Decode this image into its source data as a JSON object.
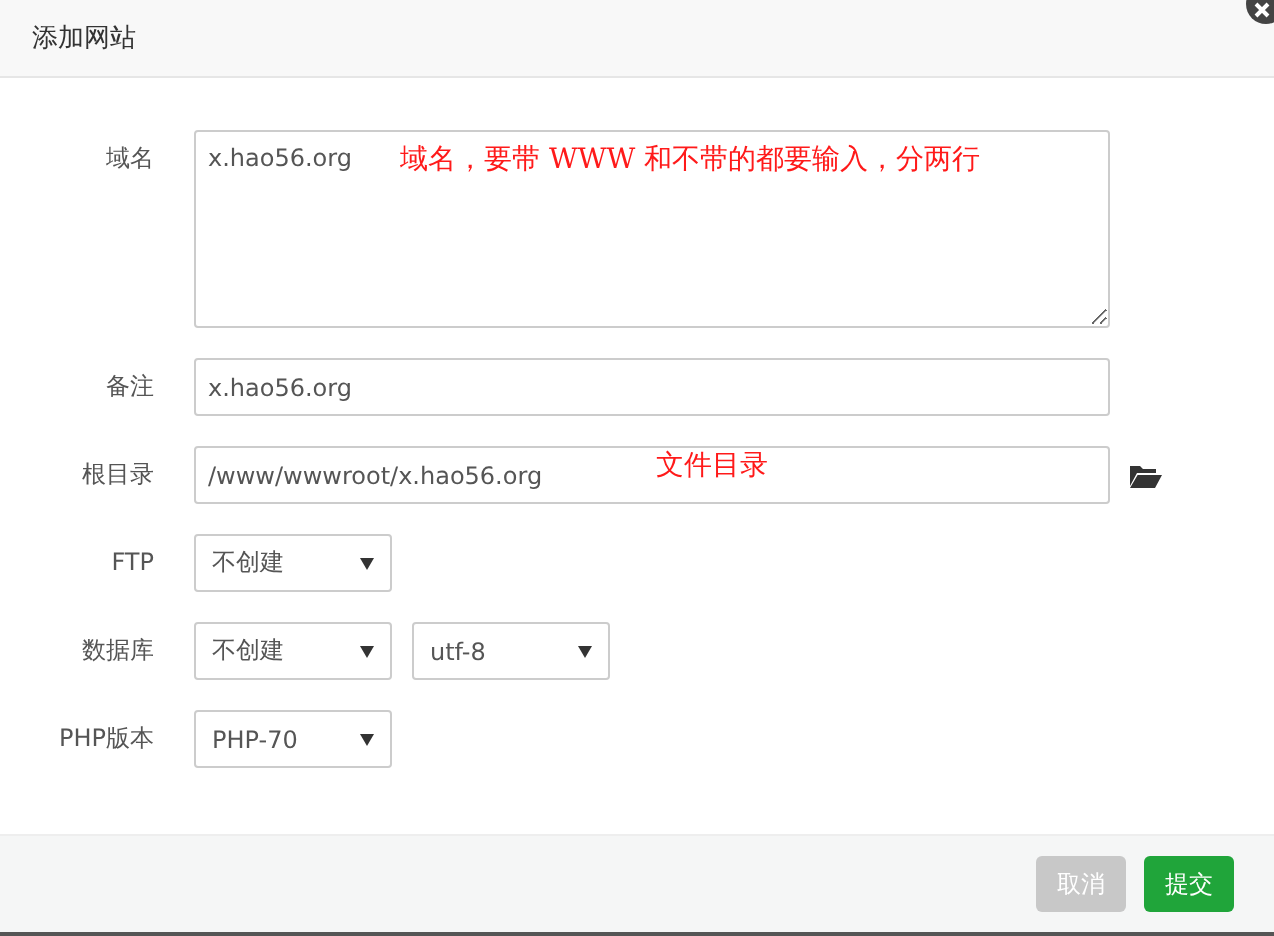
{
  "dialog": {
    "title": "添加网站",
    "closable": true
  },
  "fields": [
    {
      "kind": "textarea",
      "label": "域名",
      "value": "x.hao56.org",
      "note": "域名，要带 WWW 和不带的都要输入，分两行"
    },
    {
      "kind": "text",
      "label": "备注",
      "value": "x.hao56.org"
    },
    {
      "kind": "path",
      "label": "根目录",
      "value": "/www/wwwroot/x.hao56.org",
      "note": "文件目录"
    },
    {
      "kind": "select",
      "label": "FTP",
      "selects": [
        "不创建"
      ]
    },
    {
      "kind": "select",
      "label": "数据库",
      "selects": [
        "不创建",
        "utf-8"
      ]
    },
    {
      "kind": "select",
      "label": "PHP版本",
      "selects": [
        "PHP-70"
      ]
    }
  ],
  "buttons": [
    {
      "kind": "cancel",
      "label": "取消"
    },
    {
      "kind": "submit",
      "label": "提交"
    }
  ]
}
